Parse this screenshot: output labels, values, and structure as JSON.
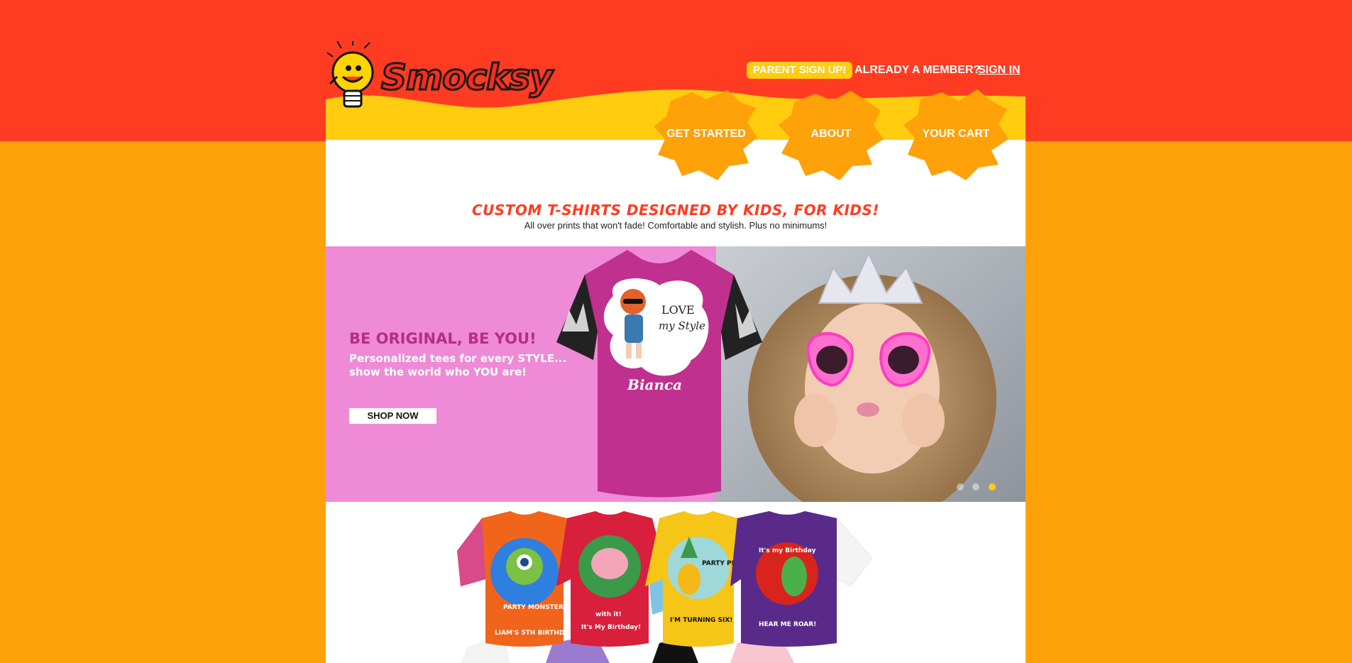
{
  "brand": {
    "name": "Smocksy"
  },
  "header": {
    "signup_label": "PARENT SIGN UP!",
    "member_text": "ALREADY A MEMBER?",
    "signin_label": "SIGN IN"
  },
  "nav": {
    "items": [
      {
        "label": "GET STARTED"
      },
      {
        "label": "ABOUT"
      },
      {
        "label": "YOUR CART"
      }
    ]
  },
  "intro": {
    "tagline": "CUSTOM T-SHIRTS DESIGNED BY KIDS, FOR KIDS!",
    "subline": "All over prints that won't fade! Comfortable and stylish. Plus no minimums!"
  },
  "hero": {
    "title": "BE ORIGINAL, BE YOU!",
    "subtitle_line1": "Personalized tees for every STYLE...",
    "subtitle_line2": "show the world who YOU are!",
    "button_label": "SHOP NOW",
    "shirt_text_1": "LOVE",
    "shirt_text_2": "my Style",
    "shirt_name": "Bianca",
    "slides": 3,
    "active_slide": 3
  },
  "products": [
    {
      "caption_top": "PARTY MONSTER",
      "caption_bottom": "LIAM'S 5TH BIRTHDAY!"
    },
    {
      "caption_top": "with it!",
      "caption_bottom": "It's My Birthday!"
    },
    {
      "caption_top": "PARTY PIN",
      "caption_bottom": "I'M TURNING SIX!"
    },
    {
      "caption_top": "It's my Birthday",
      "caption_bottom": "HEAR ME ROAR!"
    }
  ],
  "colors": {
    "page_bg": "#ffa109",
    "top_band": "#ff3c22",
    "header_yellow": "#ffcc10",
    "nav_splash": "#ffa109",
    "hero_pink": "#ef8ad6",
    "hero_title": "#b52e86",
    "tagline": "#ff3c22"
  }
}
